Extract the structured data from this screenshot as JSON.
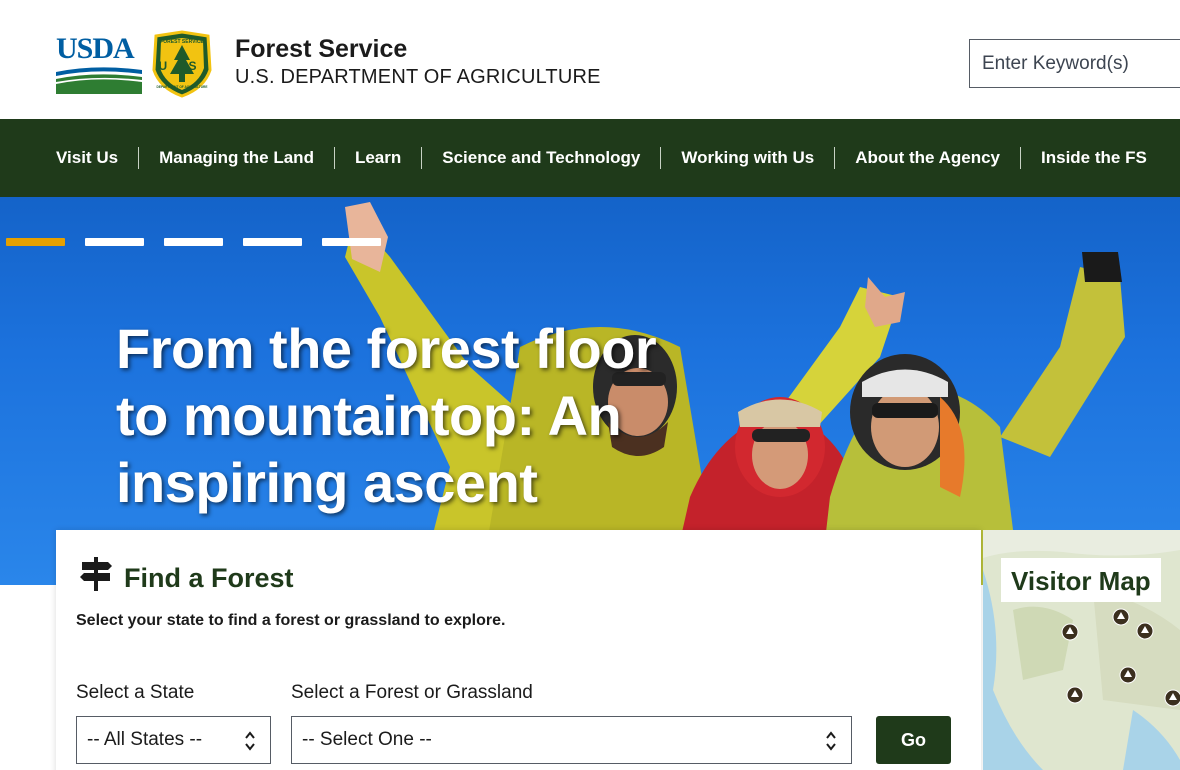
{
  "header": {
    "usda_logo_text": "USDA",
    "shield_text_top": "FOREST SERVICE",
    "shield_text_center": "U S",
    "shield_text_bottom": "DEPARTMENT OF AGRICULTURE",
    "agency_name": "Forest Service",
    "department": "U.S. DEPARTMENT OF AGRICULTURE",
    "search_placeholder": "Enter Keyword(s)"
  },
  "nav": {
    "items": [
      {
        "label": "Visit Us"
      },
      {
        "label": "Managing the Land"
      },
      {
        "label": "Learn"
      },
      {
        "label": "Science and Technology"
      },
      {
        "label": "Working with Us"
      },
      {
        "label": "About the Agency"
      },
      {
        "label": "Inside the FS"
      }
    ]
  },
  "hero": {
    "title": "From the forest floor to mountaintop: An inspiring ascent",
    "slides": 5,
    "active_slide": 1
  },
  "find_forest": {
    "title": "Find a Forest",
    "description": "Select your state to find a forest or grassland to explore.",
    "state_label": "Select a State",
    "state_value": "-- All States --",
    "forest_label": "Select a Forest or Grassland",
    "forest_value": "-- Select One --",
    "go_label": "Go"
  },
  "visitor_map": {
    "title": "Visitor Map"
  },
  "colors": {
    "nav_bg": "#1f3a1a",
    "accent_gold": "#e5a000",
    "usda_blue": "#005ea2",
    "usda_green": "#2e7d32"
  }
}
